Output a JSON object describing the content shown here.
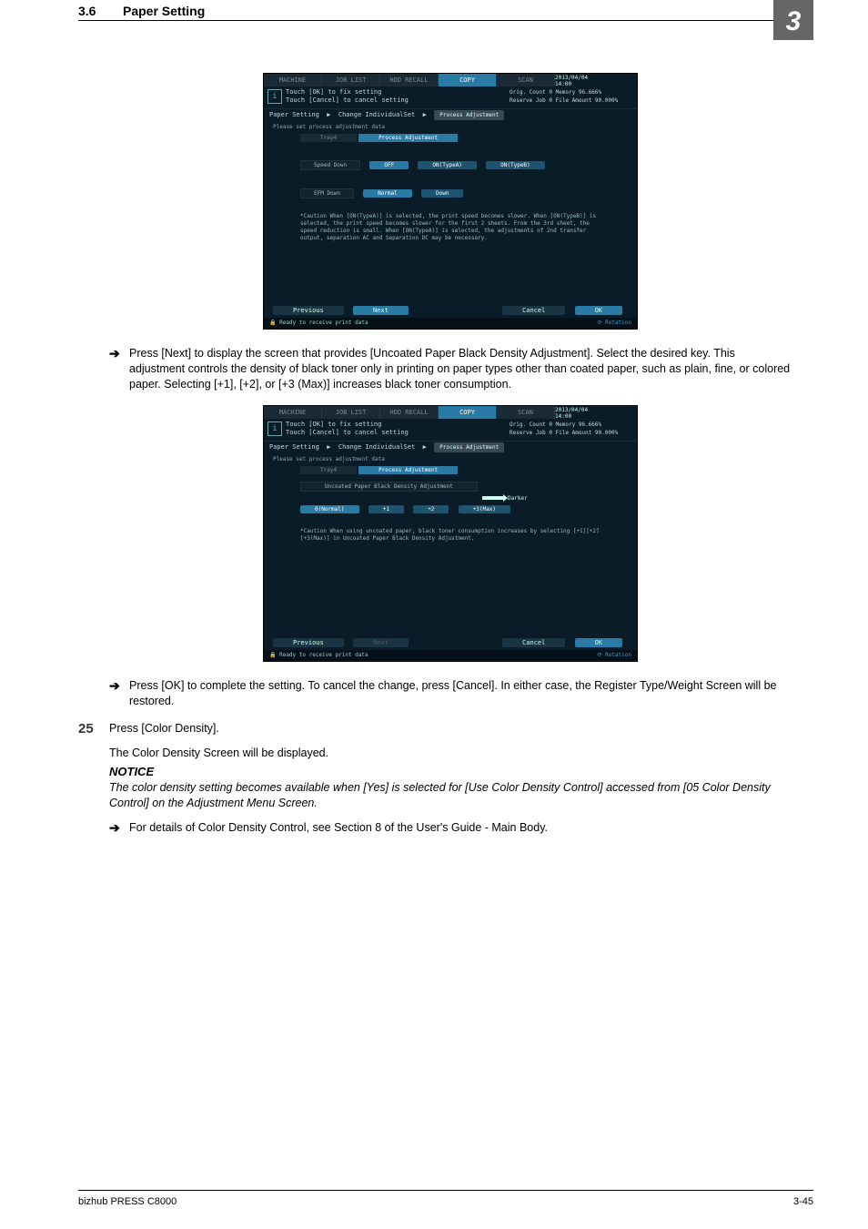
{
  "header": {
    "section_num": "3.6",
    "section_title": "Paper Setting",
    "tab_num": "3"
  },
  "footer": {
    "left": "bizhub PRESS C8000",
    "right": "3-45"
  },
  "shot1": {
    "timestamp": "2013/04/04 14:00",
    "tabs": [
      "MACHINE",
      "JOB LIST",
      "HDD RECALL",
      "COPY",
      "SCAN"
    ],
    "info1": "Touch [OK] to fix setting",
    "info2": "Touch [Cancel] to cancel setting",
    "counts_l1": "Orig. Count        0  Memory      96.666%",
    "counts_l2": "Reserve Job       0  File Amount 90.000%",
    "crumb1": "Paper Setting",
    "crumb2": "Change IndividualSet",
    "crumb3": "Process Adjustment",
    "subnote": "Please set process adjustment data",
    "minitabs": [
      "Tray4",
      "Process Adjustment"
    ],
    "row1_label": "Speed Down",
    "row1_b1": "OFF",
    "row1_b2": "ON(TypeA)",
    "row1_b3": "ON(TypeB)",
    "row2_label": "EFM Down",
    "row2_b1": "Normal",
    "row2_b2": "Down",
    "caution": "*Caution\nWhen [ON(TypeA)] is selected, the print speed becomes slower.\nWhen [ON(TypeB)] is selected, the print speed becomes slower for the first 2 sheets. From the 3rd sheet, the speed reduction is small.\nWhen [ON(TypeA)] is selected, the adjustments of 2nd transfer output, separation AC and Separation DC may be necessary.",
    "prev": "Previous",
    "next": "Next",
    "cancel": "Cancel",
    "ok": "OK",
    "status": "Ready to receive print data",
    "rot": "Rotation"
  },
  "body1": "Press [Next] to display the screen that provides [Uncoated Paper Black Density Adjustment]. Select the desired key. This adjustment controls the density of black toner only in printing on paper types other than coated paper, such as plain, fine, or colored paper. Selecting [+1], [+2], or [+3 (Max)] increases black toner consumption.",
  "shot2": {
    "timestamp": "2013/04/04 14:00",
    "tabs": [
      "MACHINE",
      "JOB LIST",
      "HDD RECALL",
      "COPY",
      "SCAN"
    ],
    "info1": "Touch [OK] to fix setting",
    "info2": "Touch [Cancel] to cancel setting",
    "counts_l1": "Orig. Count        0  Memory      96.666%",
    "counts_l2": "Reserve Job       0  File Amount 90.000%",
    "crumb1": "Paper Setting",
    "crumb2": "Change IndividualSet",
    "crumb3": "Process Adjustment",
    "subnote": "Please set process adjustment data",
    "minitabs": [
      "Tray4",
      "Process Adjustment"
    ],
    "section_label": "Uncoated Paper Black Density Adjustment",
    "darker": "Darker",
    "b0": "0(Normal)",
    "b1": "+1",
    "b2": "+2",
    "b3": "+3(Max)",
    "caution": "*Caution\nWhen using uncoated paper, black toner consumption increases by selecting [+1][+2][+3(Max)] in Uncoated Paper Black Density Adjustment.",
    "prev": "Previous",
    "next": "Next",
    "cancel": "Cancel",
    "ok": "OK",
    "status": "Ready to receive print data",
    "rot": "Rotation"
  },
  "body2": "Press [OK] to complete the setting. To cancel the change, press [Cancel]. In either case, the Register Type/Weight Screen will be restored.",
  "step25": {
    "num": "25",
    "line1": "Press [Color Density].",
    "line2": "The Color Density Screen will be displayed.",
    "notice_h": "NOTICE",
    "notice_b": "The color density setting becomes available when [Yes] is selected for [Use Color Density Control] accessed from [05 Color Density Control] on the Adjustment Menu Screen.",
    "arrow": "For details of Color Density Control, see Section 8 of the User's Guide - Main Body."
  }
}
